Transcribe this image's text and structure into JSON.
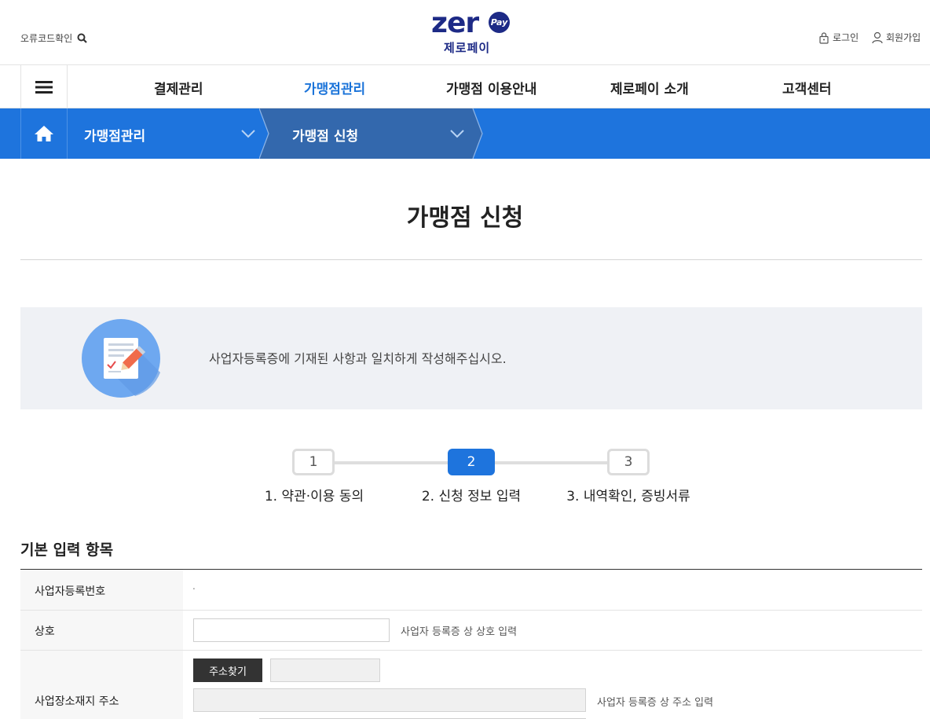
{
  "header": {
    "error_code_label": "오류코드확인",
    "logo_word": "zer",
    "logo_pay": "Pay",
    "logo_sub": "제로페이",
    "login_label": "로그인",
    "join_label": "회원가입"
  },
  "gnb": {
    "items": [
      {
        "label": "결제관리"
      },
      {
        "label": "가맹점관리"
      },
      {
        "label": "가맹점 이용안내"
      },
      {
        "label": "제로페이 소개"
      },
      {
        "label": "고객센터"
      }
    ]
  },
  "location": {
    "depth1": "가맹점관리",
    "depth2": "가맹점 신청"
  },
  "page": {
    "title": "가맹점 신청",
    "notice": "사업자등록증에 기재된 사항과 일치하게 작성해주십시오."
  },
  "steps": [
    {
      "number": "1",
      "label": "1. 약관·이용 동의"
    },
    {
      "number": "2",
      "label": "2. 신청 정보 입력"
    },
    {
      "number": "3",
      "label": "3. 내역확인, 증빙서류"
    }
  ],
  "form": {
    "section_title": "기본 입력 항목",
    "rows": {
      "bizno": {
        "label": "사업자등록번호",
        "value": "."
      },
      "name": {
        "label": "상호",
        "value": "",
        "hint": "사업자 등록증 상 상호 입력"
      },
      "address": {
        "label": "사업장소재지 주소",
        "search_button": "주소찾기",
        "hint": "사업자 등록증 상 주소 입력"
      }
    }
  },
  "colors": {
    "brand_navy": "#1d2a86",
    "accent_blue": "#1e74dd"
  }
}
